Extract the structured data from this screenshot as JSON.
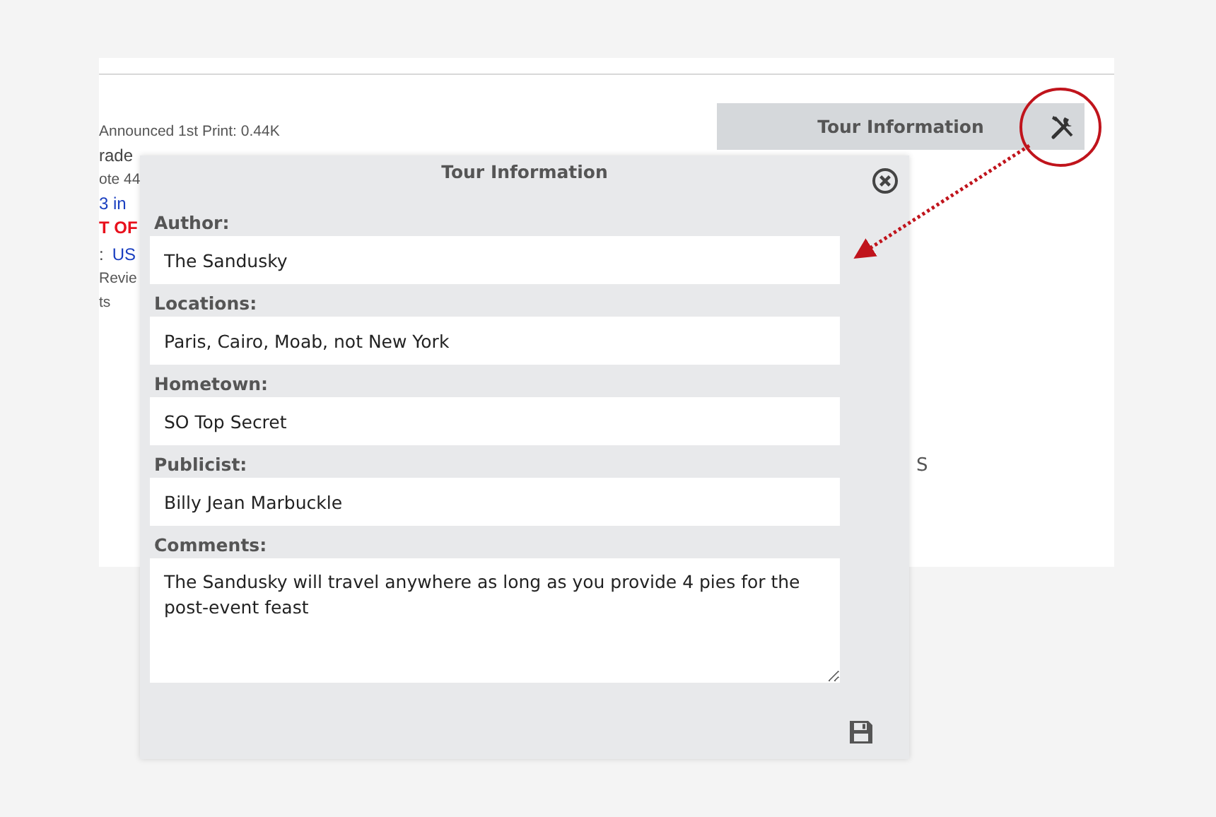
{
  "background_page": {
    "lines": [
      {
        "kind": "small",
        "text": "Announced 1st Print: 0.44K"
      },
      {
        "kind": "normal",
        "text": "rade"
      },
      {
        "kind": "small",
        "text": "ote 44"
      },
      {
        "kind": "blue",
        "text": "3 in"
      },
      {
        "kind": "alert",
        "text": "T OF"
      },
      {
        "kind": "link",
        "prefix": ":",
        "text": "US"
      },
      {
        "kind": "small",
        "text": "Revie"
      },
      {
        "kind": "small",
        "text": "ts"
      }
    ],
    "panel_header": {
      "title": "Tour Information"
    },
    "right_text": "S"
  },
  "dialog": {
    "title": "Tour Information",
    "fields": [
      {
        "kind": "input",
        "label": "Author:",
        "value": "The Sandusky"
      },
      {
        "kind": "input",
        "label": "Locations:",
        "value": "Paris, Cairo, Moab, not New York"
      },
      {
        "kind": "input",
        "label": "Hometown:",
        "value": "SO Top Secret"
      },
      {
        "kind": "input",
        "label": "Publicist:",
        "value": "Billy Jean Marbuckle"
      },
      {
        "kind": "textarea",
        "label": "Comments:",
        "value": "The Sandusky will travel anywhere as long as you provide 4 pies for the post-event feast"
      }
    ]
  }
}
